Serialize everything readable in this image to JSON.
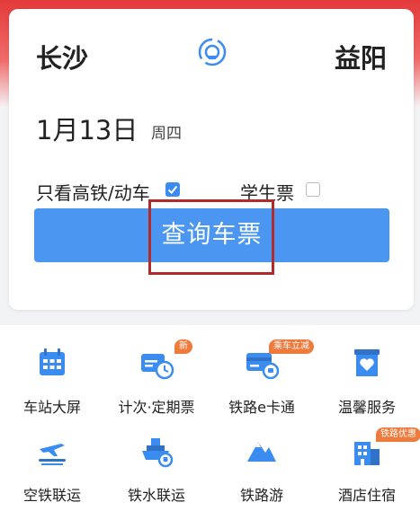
{
  "route": {
    "from": "长沙",
    "to": "益阳",
    "swap_icon": "swap-stations-icon"
  },
  "date": {
    "day": "1月13日",
    "weekday": "周四"
  },
  "options": {
    "high_speed_label": "只看高铁/动车",
    "high_speed_checked": true,
    "student_label": "学生票",
    "student_checked": false
  },
  "query_button": {
    "label": "查询车票"
  },
  "services": [
    {
      "label": "车站大屏",
      "icon": "calendar-screen-icon",
      "badge": ""
    },
    {
      "label": "计次·定期票",
      "icon": "ticket-clock-icon",
      "badge": "新"
    },
    {
      "label": "铁路e卡通",
      "icon": "rail-card-icon",
      "badge": "乘车立减"
    },
    {
      "label": "温馨服务",
      "icon": "heart-service-icon",
      "badge": ""
    },
    {
      "label": "空铁联运",
      "icon": "plane-train-icon",
      "badge": ""
    },
    {
      "label": "铁水联运",
      "icon": "ship-train-icon",
      "badge": ""
    },
    {
      "label": "铁路游",
      "icon": "mountain-travel-icon",
      "badge": ""
    },
    {
      "label": "酒店住宿",
      "icon": "hotel-building-icon",
      "badge": "铁路优惠"
    }
  ],
  "colors": {
    "accent": "#4a96f0",
    "banner": "#e33a3a",
    "badge": "#ee7a3c",
    "highlight": "#b42a2a"
  }
}
